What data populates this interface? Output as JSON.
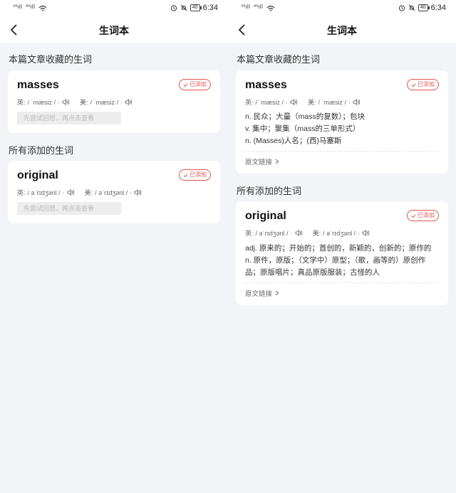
{
  "status": {
    "signal1": "³⁶ıll",
    "signal2": "⁴⁶ıll",
    "battery": "40",
    "time": "6:34"
  },
  "nav": {
    "title": "生词本"
  },
  "sections": {
    "article": "本篇文章收藏的生词",
    "all": "所有添加的生词"
  },
  "words": {
    "masses": {
      "word": "masses",
      "added": "已添加",
      "uk_label": "英:",
      "uk_phon": "/ ˈmæsiz /",
      "us_label": "美:",
      "us_phon": "/ ˈmæsiz /",
      "hint": "先尝试回想，再点击查看",
      "defs": [
        "n. 民众；大量（mass的复数）；包块",
        "v. 集中；聚集（mass的三单形式）",
        "n. (Masses)人名；(西)马塞斯"
      ],
      "link": "原文链接"
    },
    "original": {
      "word": "original",
      "added": "已添加",
      "uk_label": "英:",
      "uk_phon": "/ əˈrɪdʒənl /",
      "us_label": "美:",
      "us_phon": "/ əˈrɪdʒənl /",
      "hint": "先尝试回想，再点击查看",
      "defs": [
        "adj. 原来的；开始的；首创的，新颖的，创新的；原作的",
        "n. 原件，原版；（文学中）原型；（歌，画等的）原创作品；原版唱片；真品原版服装；古怪的人"
      ],
      "link": "原文链接"
    }
  },
  "icons": {
    "back": "back-arrow-icon",
    "speaker": "speaker-icon",
    "check": "check-icon",
    "alarm": "alarm-icon",
    "mute": "bell-off-icon",
    "wifi": "wifi-icon",
    "chevron": "chevron-right-icon"
  },
  "colors": {
    "accent": "#e0554f",
    "background": "#f3f4f8",
    "card": "#ffffff"
  }
}
